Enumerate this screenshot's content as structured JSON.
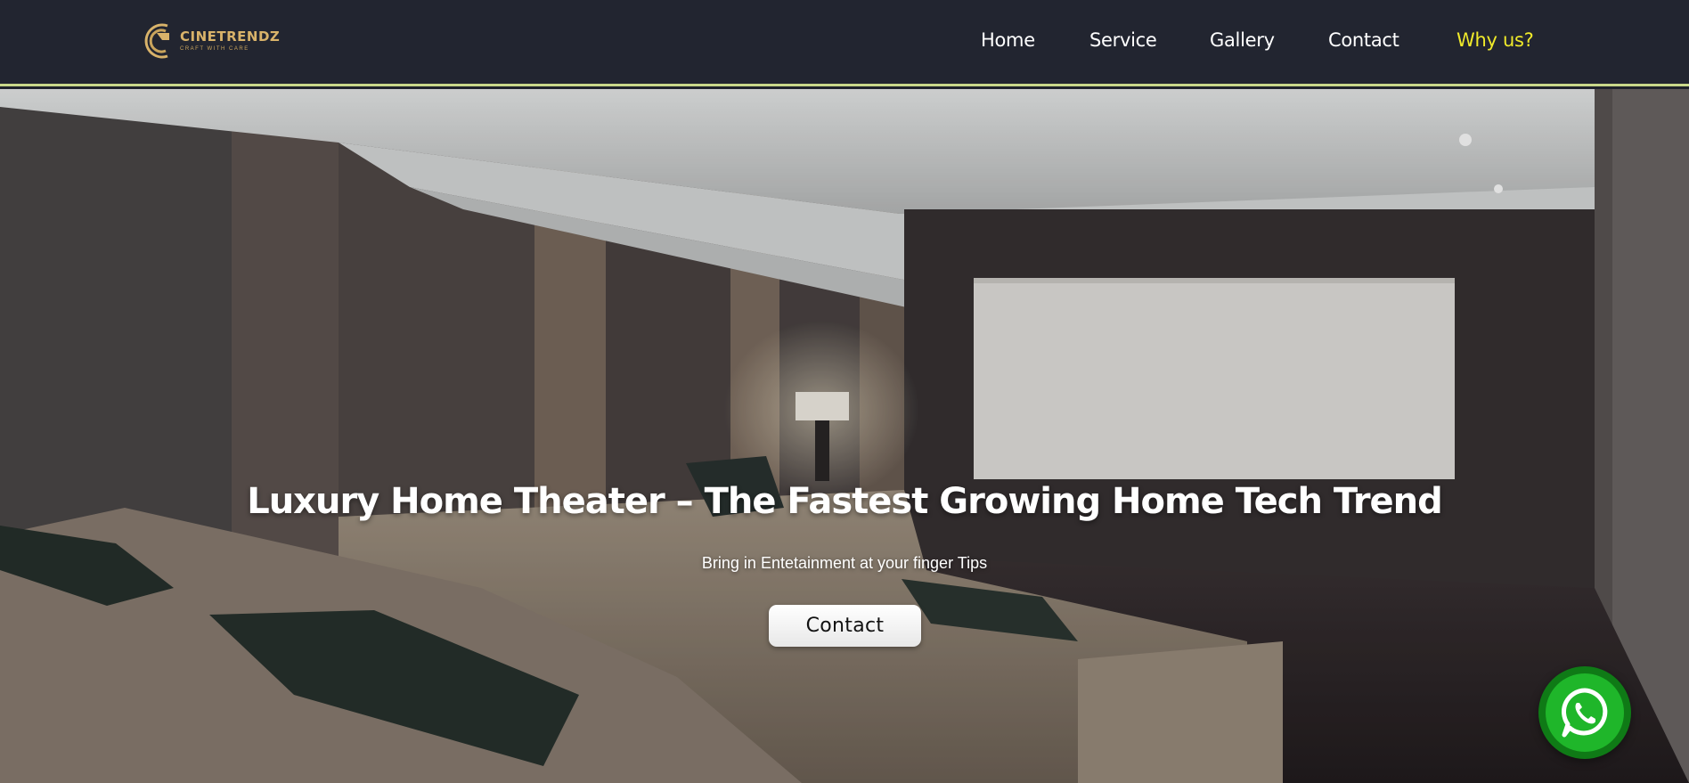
{
  "brand": {
    "name": "CINETRENDZ",
    "tagline": "CRAFT WITH CARE",
    "gold": "#d9b36a"
  },
  "nav": {
    "items": [
      {
        "label": "Home"
      },
      {
        "label": "Service"
      },
      {
        "label": "Gallery"
      },
      {
        "label": "Contact"
      },
      {
        "label": "Why us?"
      }
    ],
    "active_color": "#f0ea2a"
  },
  "hero": {
    "title": "Luxury Home Theater – The Fastest Growing Home Tech Trend",
    "subtitle": "Bring in Entetainment at your finger Tips",
    "cta_label": "Contact"
  },
  "whatsapp": {
    "icon": "whatsapp-icon",
    "color": "#1fb62a"
  },
  "colors": {
    "header_bg": "#222530",
    "header_border": "#c9d88a"
  }
}
